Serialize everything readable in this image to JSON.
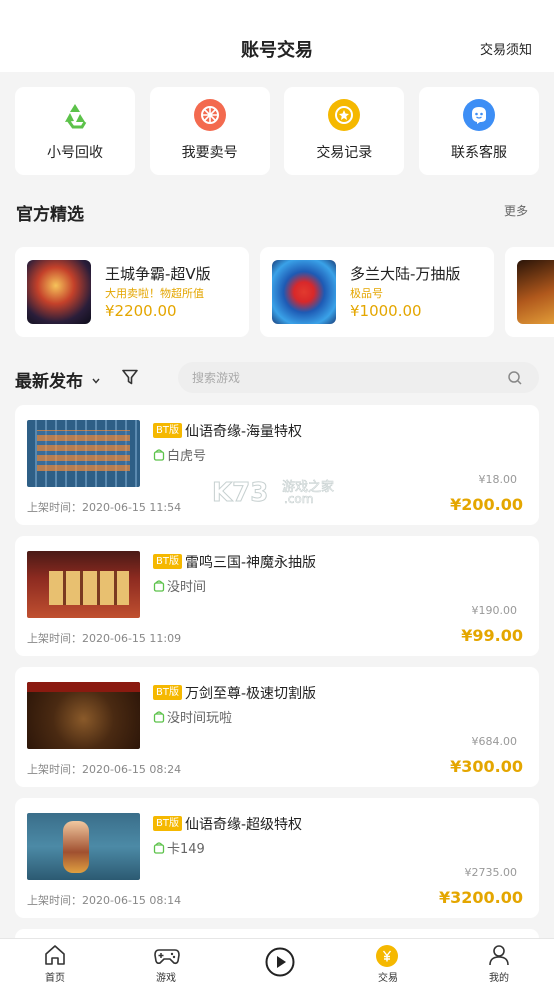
{
  "header": {
    "title": "账号交易",
    "notice": "交易须知"
  },
  "quick_actions": [
    {
      "label": "小号回收",
      "icon": "recycle-icon",
      "color": "#5cc24a"
    },
    {
      "label": "我要卖号",
      "icon": "sell-icon",
      "color": "#f36a4f"
    },
    {
      "label": "交易记录",
      "icon": "record-icon",
      "color": "#f5b800"
    },
    {
      "label": "联系客服",
      "icon": "service-icon",
      "color": "#3d8ef5"
    }
  ],
  "featured": {
    "title": "官方精选",
    "more": "更多",
    "items": [
      {
        "name": "王城争霸-超V版",
        "tag": "大用卖啦！物超所值",
        "price": "¥2200.00"
      },
      {
        "name": "多兰大陆-万抽版",
        "tag": "极品号",
        "price": "¥1000.00"
      }
    ]
  },
  "latest": {
    "title": "最新发布",
    "search_placeholder": "搜索游戏",
    "items": [
      {
        "badge": "BT版",
        "name": "仙语奇缘-海量特权",
        "account": "白虎号",
        "orig_price": "¥18.00",
        "price": "¥200.00",
        "date": "上架时间：2020-06-15 11:54"
      },
      {
        "badge": "BT版",
        "name": "雷鸣三国-神魔永抽版",
        "account": "没时间",
        "orig_price": "¥190.00",
        "price": "¥99.00",
        "date": "上架时间：2020-06-15 11:09"
      },
      {
        "badge": "BT版",
        "name": "万剑至尊-极速切割版",
        "account": "没时间玩啦",
        "orig_price": "¥684.00",
        "price": "¥300.00",
        "date": "上架时间：2020-06-15 08:24"
      },
      {
        "badge": "BT版",
        "name": "仙语奇缘-超级特权",
        "account": "卡149",
        "orig_price": "¥2735.00",
        "price": "¥3200.00",
        "date": "上架时间：2020-06-15 08:14"
      }
    ]
  },
  "watermark": {
    "text": "K73",
    "sub": "游戏之家",
    "domain": ".com"
  },
  "tabbar": {
    "tabs": [
      {
        "label": "首页",
        "icon": "home-icon"
      },
      {
        "label": "游戏",
        "icon": "gamepad-icon"
      },
      {
        "label": "",
        "icon": "play-icon"
      },
      {
        "label": "交易",
        "icon": "yen-icon",
        "active": true
      },
      {
        "label": "我的",
        "icon": "user-icon"
      }
    ]
  },
  "colors": {
    "accent": "#f5b800",
    "price": "#e4a600"
  }
}
